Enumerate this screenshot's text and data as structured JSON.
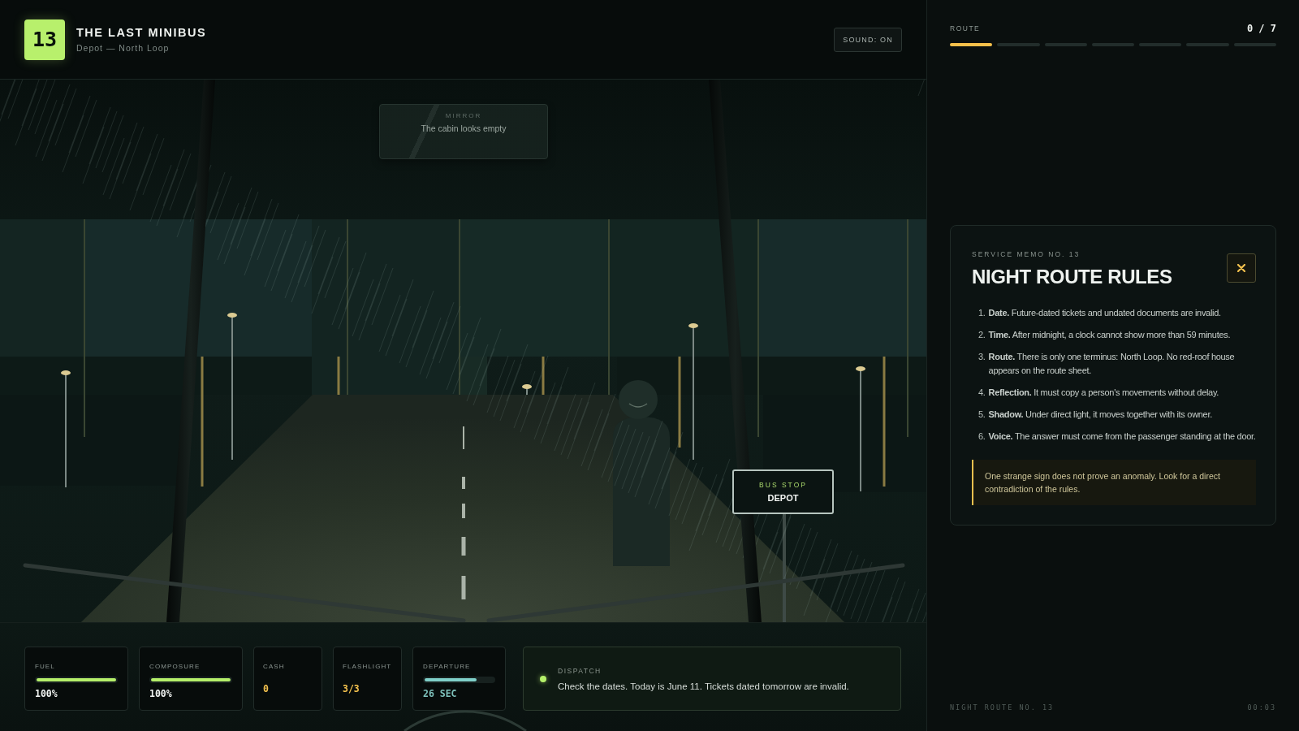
{
  "header": {
    "badge": "13",
    "title": "THE LAST MINIBUS",
    "subtitle": "Depot — North Loop",
    "sound_button": "SOUND: ON"
  },
  "scene": {
    "mirror": {
      "label": "MIRROR",
      "text": "The cabin looks empty"
    },
    "bus_stop": {
      "label": "BUS STOP",
      "name": "DEPOT"
    }
  },
  "stats": [
    {
      "kind": "meter",
      "label": "FUEL",
      "level": 1,
      "value": "100%"
    },
    {
      "kind": "meter",
      "label": "COMPOSURE",
      "level": 1,
      "value": "100%"
    },
    {
      "kind": "count",
      "label": "CASH",
      "value": "0"
    },
    {
      "kind": "count",
      "label": "FLASHLIGHT",
      "value": "3/3"
    },
    {
      "kind": "timer",
      "label": "DEPARTURE",
      "level": 0.75,
      "value": "26 SEC"
    }
  ],
  "dispatch": {
    "label": "DISPATCH",
    "message": "Check the dates. Today is June 11. Tickets dated tomorrow are invalid."
  },
  "route": {
    "label": "ROUTE",
    "count": "0 / 7",
    "segments": [
      {
        "current": true
      },
      {
        "current": false
      },
      {
        "current": false
      },
      {
        "current": false
      },
      {
        "current": false
      },
      {
        "current": false
      },
      {
        "current": false
      }
    ]
  },
  "memo": {
    "kicker": "SERVICE MEMO NO. 13",
    "title": "NIGHT ROUTE RULES",
    "rules": [
      {
        "number": "1.",
        "text": "**Date.** Future-dated tickets and undated documents are invalid."
      },
      {
        "number": "2.",
        "text": "**Time.** After midnight, a clock cannot show more than 59 minutes."
      },
      {
        "number": "3.",
        "text": "**Route.** There is only one terminus: North Loop. No red-roof house appears on the route sheet."
      },
      {
        "number": "4.",
        "text": "**Reflection.** It must copy a person's movements without delay."
      },
      {
        "number": "5.",
        "text": "**Shadow.** Under direct light, it moves together with its owner."
      },
      {
        "number": "6.",
        "text": "**Voice.** The answer must come from the passenger standing at the door."
      }
    ],
    "note": "One strange sign does not prove an anomaly. Look for a direct contradiction of the rules."
  },
  "footer": {
    "route_name": "NIGHT ROUTE NO. 13",
    "clock": "00:03"
  }
}
